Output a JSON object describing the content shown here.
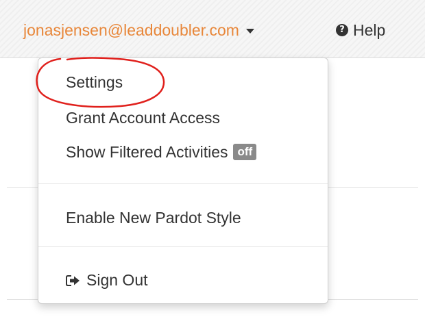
{
  "header": {
    "user_email": "jonasjensen@leaddoubler.com",
    "help_label": "Help"
  },
  "menu": {
    "items": [
      {
        "label": "Settings"
      },
      {
        "label": "Grant Account Access"
      },
      {
        "label": "Show Filtered Activities",
        "badge": "off"
      },
      {
        "label": "Enable New Pardot Style"
      },
      {
        "label": "Sign Out"
      }
    ]
  },
  "colors": {
    "accent": "#e8873a",
    "annotation": "#e0201c",
    "badge": "#8a8a8a"
  },
  "icons": {
    "help": "question-circle-icon",
    "dropdown": "caret-down-icon",
    "sign_out": "sign-out-icon"
  }
}
